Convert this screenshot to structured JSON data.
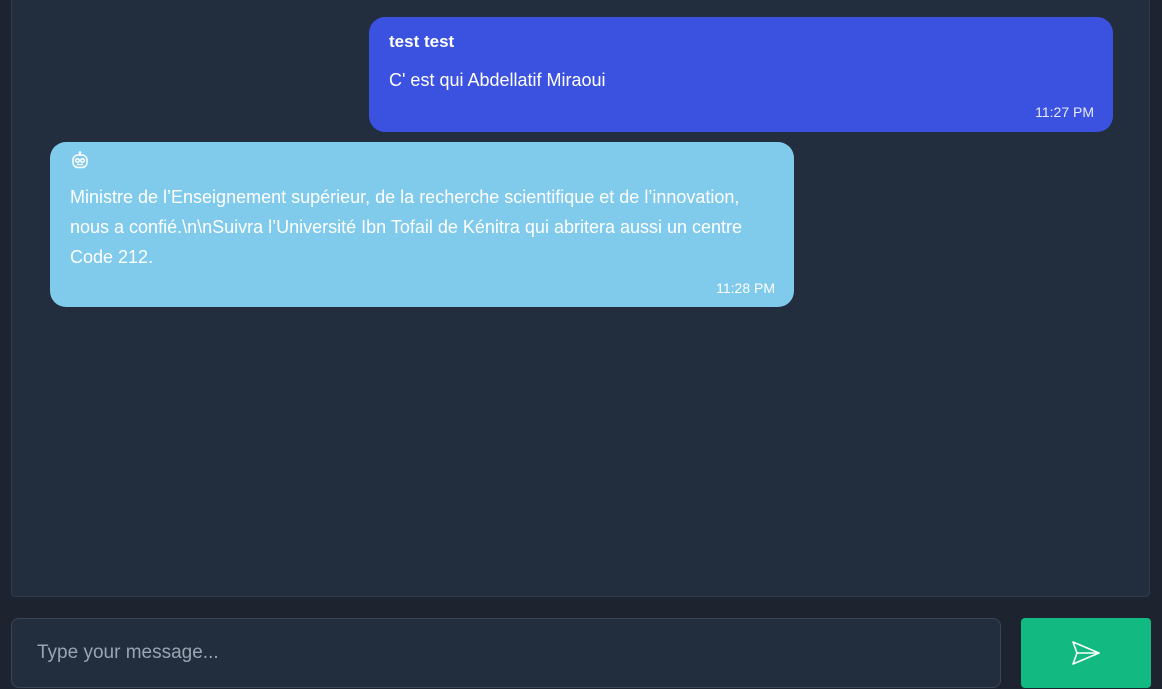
{
  "messages": {
    "user": {
      "name": "test test",
      "text": "C' est qui Abdellatif Miraoui",
      "time": "11:27 PM",
      "color": "#3b51e0"
    },
    "bot": {
      "icon": "robot-icon",
      "text": "Ministre de l’Enseignement supérieur, de la recherche scientifique et de l’innovation, nous a confié.\\n\\nSuivra l’Université Ibn Tofail de Kénitra qui abritera aussi un centre Code 212.",
      "time": "11:28 PM",
      "color": "#80caec"
    }
  },
  "composer": {
    "placeholder": "Type your message...",
    "send_icon": "send-icon",
    "send_color": "#12b981"
  }
}
